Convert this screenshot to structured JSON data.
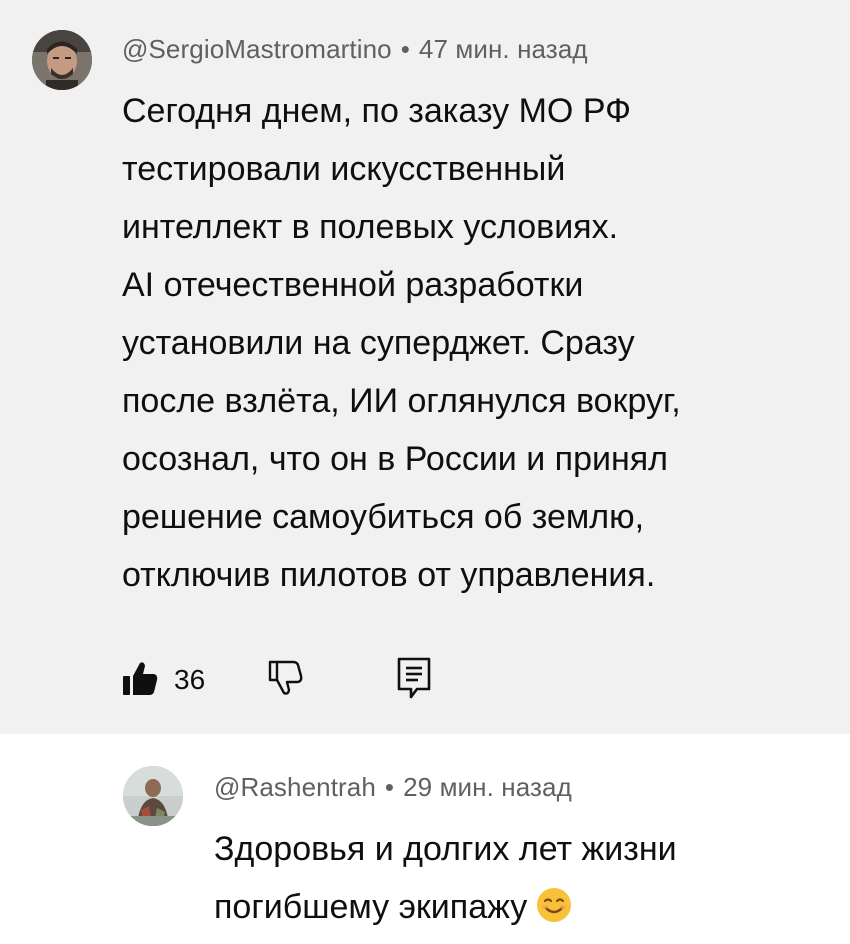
{
  "main_comment": {
    "author": "@SergioMastromartino",
    "separator": "•",
    "time": "47 мин. назад",
    "lines": [
      "Сегодня днем, по заказу МО РФ",
      "тестировали искусственный",
      "интеллект в полевых условиях.",
      "AI отечественной разработки",
      "установили на суперджет. Сразу",
      "после взлёта, ИИ оглянулся вокруг,",
      "осознал, что он в России и принял",
      "решение самоубиться об землю,",
      "отключив пилотов от управления."
    ],
    "like_count": "36",
    "icons": {
      "like": "thumb-up-filled-icon",
      "dislike": "thumb-down-outline-icon",
      "reply": "comment-reply-icon"
    },
    "background": "#f1f1f1"
  },
  "reply": {
    "author": "@Rashentrah",
    "separator": "•",
    "time": "29 мин. назад",
    "lines": [
      "Здоровья и долгих лет жизни",
      "погибшему экипажу"
    ],
    "emoji": "smiling-face-emoji"
  },
  "colors": {
    "meta": "#606060",
    "text": "#0f0f0f",
    "emoji": "#f7c23a"
  }
}
